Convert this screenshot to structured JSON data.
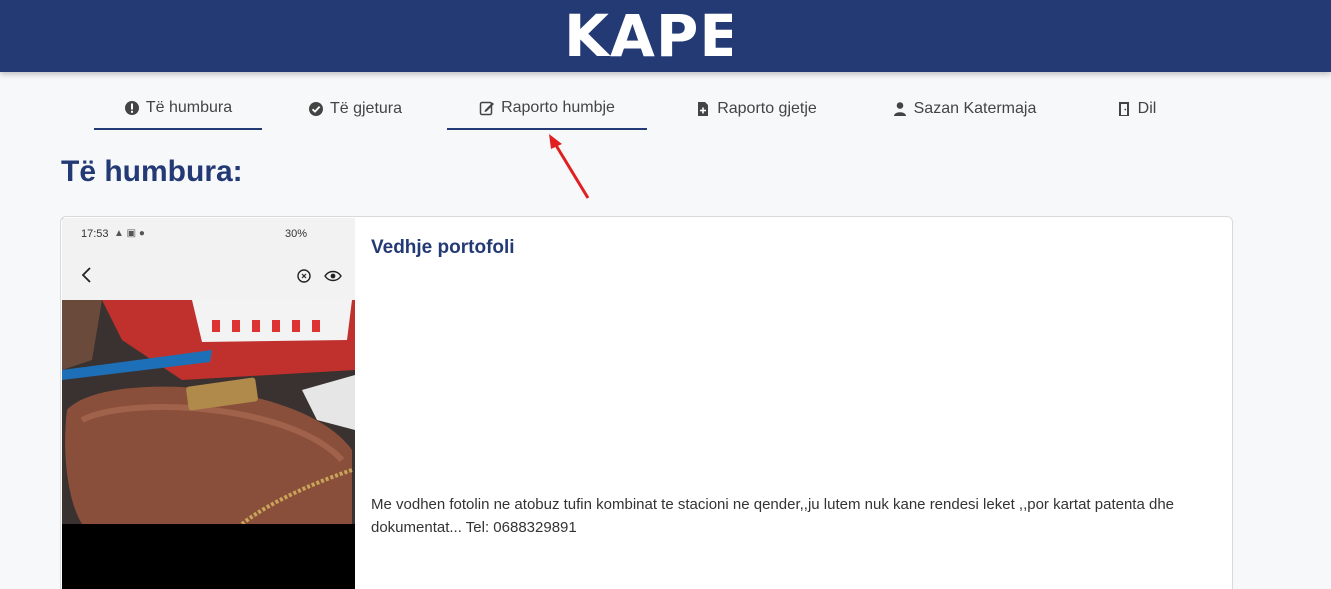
{
  "header": {
    "logo": "KAPE",
    "bg_color": "#233a75"
  },
  "nav": {
    "items": [
      {
        "label": "Të humbura",
        "icon": "exclamation-circle-icon",
        "active": true
      },
      {
        "label": "Të gjetura",
        "icon": "check-circle-icon",
        "active": false
      },
      {
        "label": "Raporto humbje",
        "icon": "edit-icon",
        "active": true
      },
      {
        "label": "Raporto gjetje",
        "icon": "file-plus-icon",
        "active": false
      },
      {
        "label": "Sazan Katermaja",
        "icon": "user-icon",
        "active": false
      },
      {
        "label": "Dil",
        "icon": "door-icon",
        "active": false
      }
    ]
  },
  "page": {
    "title": "Të humbura:"
  },
  "card": {
    "title": "Vedhje portofoli",
    "description": "Me vodhen fotolin ne atobuz tufin kombinat te stacioni ne qender,,ju lutem nuk kane rendesi leket ,,por kartat patenta dhe dokumentat... Tel: 0688329891",
    "photo": {
      "status_time": "17:53",
      "status_battery": "30%"
    }
  },
  "annotation": {
    "color": "#e02020"
  }
}
